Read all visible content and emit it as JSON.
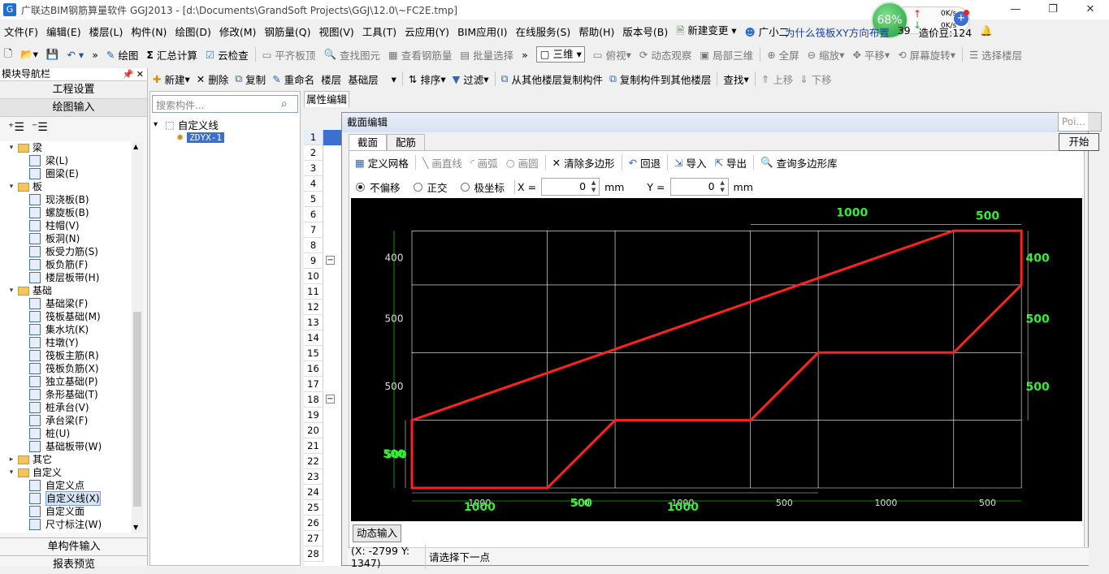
{
  "window": {
    "title": "广联达BIM钢筋算量软件 GGJ2013 - [d:\\Documents\\GrandSoft Projects\\GGJ\\12.0\\~FC2E.tmp]",
    "app_icon": "G"
  },
  "net_widget": {
    "percent": "68%",
    "up_rate": "0K/s",
    "down_rate": "0K/s"
  },
  "menu": [
    "文件(F)",
    "编辑(E)",
    "楼层(L)",
    "构件(N)",
    "绘图(D)",
    "修改(M)",
    "钢筋量(Q)",
    "视图(V)",
    "工具(T)",
    "云应用(Y)",
    "BIM应用(I)",
    "在线服务(S)",
    "帮助(H)",
    "版本号(B)",
    "新建变更",
    "广小二"
  ],
  "menu_right": {
    "question": "为什么筏板XY方向布置",
    "num": "39",
    "cost": "造价豆:124"
  },
  "toolbar1": {
    "draw": "绘图",
    "sum": "汇总计算",
    "cloud_check": "云检查",
    "flat_top": "平齐板顶",
    "find": "查找图元",
    "view_rebar": "查看钢筋量",
    "batch_select": "批量选择",
    "view3d": "三维",
    "top_view": "俯视",
    "dynamic_view": "动态观察",
    "local3d": "局部三维",
    "fullscreen": "全屏",
    "zoom": "缩放",
    "pan": "平移",
    "rotate": "屏幕旋转",
    "select_floor": "选择楼层"
  },
  "left_panel": {
    "header": "模块导航栏",
    "project_settings": "工程设置",
    "draw_input": "绘图输入",
    "tree": [
      {
        "type": "folder",
        "label": "梁"
      },
      {
        "type": "item",
        "label": "梁(L)"
      },
      {
        "type": "item",
        "label": "圈梁(E)"
      },
      {
        "type": "folder",
        "label": "板"
      },
      {
        "type": "item",
        "label": "现浇板(B)"
      },
      {
        "type": "item",
        "label": "螺旋板(B)"
      },
      {
        "type": "item",
        "label": "柱帽(V)"
      },
      {
        "type": "item",
        "label": "板洞(N)"
      },
      {
        "type": "item",
        "label": "板受力筋(S)"
      },
      {
        "type": "item",
        "label": "板负筋(F)"
      },
      {
        "type": "item",
        "label": "楼层板带(H)"
      },
      {
        "type": "folder",
        "label": "基础"
      },
      {
        "type": "item",
        "label": "基础梁(F)"
      },
      {
        "type": "item",
        "label": "筏板基础(M)"
      },
      {
        "type": "item",
        "label": "集水坑(K)"
      },
      {
        "type": "item",
        "label": "柱墩(Y)"
      },
      {
        "type": "item",
        "label": "筏板主筋(R)"
      },
      {
        "type": "item",
        "label": "筏板负筋(X)"
      },
      {
        "type": "item",
        "label": "独立基础(P)"
      },
      {
        "type": "item",
        "label": "条形基础(T)"
      },
      {
        "type": "item",
        "label": "桩承台(V)"
      },
      {
        "type": "item",
        "label": "承台梁(F)"
      },
      {
        "type": "item",
        "label": "桩(U)"
      },
      {
        "type": "item",
        "label": "基础板带(W)"
      },
      {
        "type": "folder-collapsed",
        "label": "其它"
      },
      {
        "type": "folder",
        "label": "自定义"
      },
      {
        "type": "item",
        "label": "自定义点"
      },
      {
        "type": "item-selected",
        "label": "自定义线(X)"
      },
      {
        "type": "item",
        "label": "自定义面"
      },
      {
        "type": "item",
        "label": "尺寸标注(W)"
      }
    ],
    "single_input": "单构件输入",
    "report": "报表预览"
  },
  "toolbar2": {
    "new": "新建",
    "delete": "删除",
    "copy": "复制",
    "rename": "重命名",
    "floor": "楼层",
    "floor_value": "基础层",
    "sort": "排序",
    "filter": "过滤",
    "copy_from": "从其他楼层复制构件",
    "copy_to": "复制构件到其他楼层",
    "find": "查找",
    "move_up": "上移",
    "move_down": "下移"
  },
  "mid_panel": {
    "search_placeholder": "搜索构件...",
    "root": "自定义线",
    "child": "ZDYX-1"
  },
  "prop_tab": "属性编辑",
  "row_numbers": [
    "1",
    "2",
    "3",
    "4",
    "5",
    "6",
    "7",
    "8",
    "9",
    "10",
    "11",
    "12",
    "13",
    "14",
    "15",
    "16",
    "17",
    "18",
    "19",
    "20",
    "21",
    "22",
    "23",
    "24",
    "25",
    "26",
    "27",
    "28"
  ],
  "dialog": {
    "title": "截面编辑",
    "tabs": [
      "截面",
      "配筋"
    ],
    "tools": {
      "define_grid": "定义网格",
      "line": "画直线",
      "arc": "画弧",
      "circle": "画圆",
      "clear": "清除多边形",
      "undo": "回退",
      "import": "导入",
      "export": "导出",
      "query": "查询多边形库"
    },
    "options": {
      "no_offset": "不偏移",
      "ortho": "正交",
      "polar": "极坐标",
      "x_label": "X =",
      "x_value": "0",
      "y_label": "Y =",
      "y_value": "0",
      "unit": "mm"
    },
    "dynamic_input": "动态输入",
    "status_coord": "(X: -2799 Y: 1347)",
    "status_msg": "请选择下一点"
  },
  "point_panel": {
    "placeholder": "Poi...",
    "start": "开始"
  },
  "chart_data": {
    "type": "diagram",
    "grid_x": [
      0,
      1000,
      1500,
      2500,
      3000,
      4000,
      4500
    ],
    "grid_y": [
      0,
      500,
      1000,
      1500,
      1900
    ],
    "polygon": [
      [
        0,
        0
      ],
      [
        1000,
        0
      ],
      [
        1500,
        500
      ],
      [
        2500,
        500
      ],
      [
        3000,
        1000
      ],
      [
        4000,
        1000
      ],
      [
        4500,
        1500
      ],
      [
        4500,
        1900
      ],
      [
        4000,
        1900
      ],
      [
        0,
        500
      ]
    ],
    "top_dims": [
      "1000",
      "500"
    ],
    "left_dims": [
      "400",
      "500",
      "500",
      "500"
    ],
    "right_dims": [
      "400",
      "500",
      "500"
    ],
    "bottom_dims_white": [
      "1000",
      "500",
      "1000",
      "500",
      "1000",
      "500"
    ],
    "bottom_dims_green": [
      "1000",
      "500",
      "1000"
    ],
    "overlap_label": "500",
    "colors": {
      "grid": "#ffffff",
      "polygon": "#ff2020",
      "dim_green": "#33ee33",
      "dim_white": "#dddddd"
    }
  }
}
